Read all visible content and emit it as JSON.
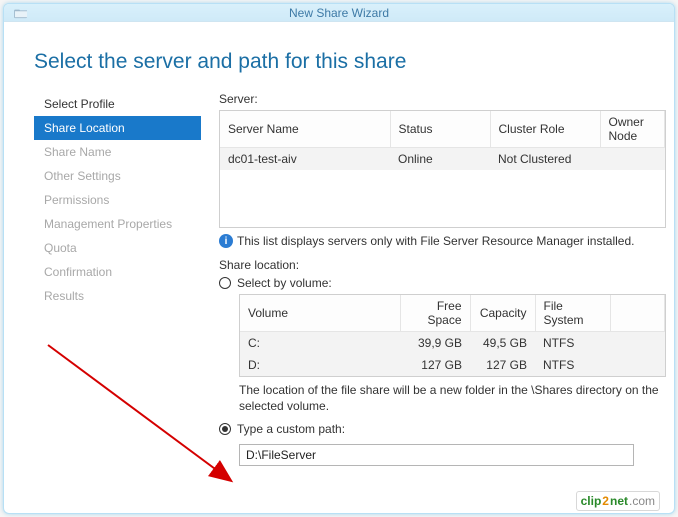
{
  "window": {
    "title": "New Share Wizard"
  },
  "heading": "Select the server and path for this share",
  "sidebar": {
    "items": [
      {
        "label": "Select Profile",
        "state": "done"
      },
      {
        "label": "Share Location",
        "state": "active"
      },
      {
        "label": "Share Name",
        "state": "disabled"
      },
      {
        "label": "Other Settings",
        "state": "disabled"
      },
      {
        "label": "Permissions",
        "state": "disabled"
      },
      {
        "label": "Management Properties",
        "state": "disabled"
      },
      {
        "label": "Quota",
        "state": "disabled"
      },
      {
        "label": "Confirmation",
        "state": "disabled"
      },
      {
        "label": "Results",
        "state": "disabled"
      }
    ]
  },
  "server": {
    "label": "Server:",
    "columns": [
      "Server Name",
      "Status",
      "Cluster Role",
      "Owner Node"
    ],
    "rows": [
      {
        "name": "dc01-test-aiv",
        "status": "Online",
        "cluster": "Not Clustered",
        "owner": ""
      }
    ],
    "info": "This list displays servers only with File Server Resource Manager installed."
  },
  "location": {
    "label": "Share location:",
    "option_volume": "Select by volume:",
    "option_custom": "Type a custom path:",
    "selected": "custom",
    "vol_columns": [
      "Volume",
      "Free Space",
      "Capacity",
      "File System"
    ],
    "volumes": [
      {
        "name": "C:",
        "free": "39,9 GB",
        "cap": "49,5 GB",
        "fs": "NTFS"
      },
      {
        "name": "D:",
        "free": "127 GB",
        "cap": "127 GB",
        "fs": "NTFS"
      }
    ],
    "hint": "The location of the file share will be a new folder in the \\Shares directory on the selected volume.",
    "custom_path": "D:\\FileServer"
  },
  "watermark": {
    "a": "clip",
    "b": "2",
    "c": "net",
    "d": ".com"
  }
}
